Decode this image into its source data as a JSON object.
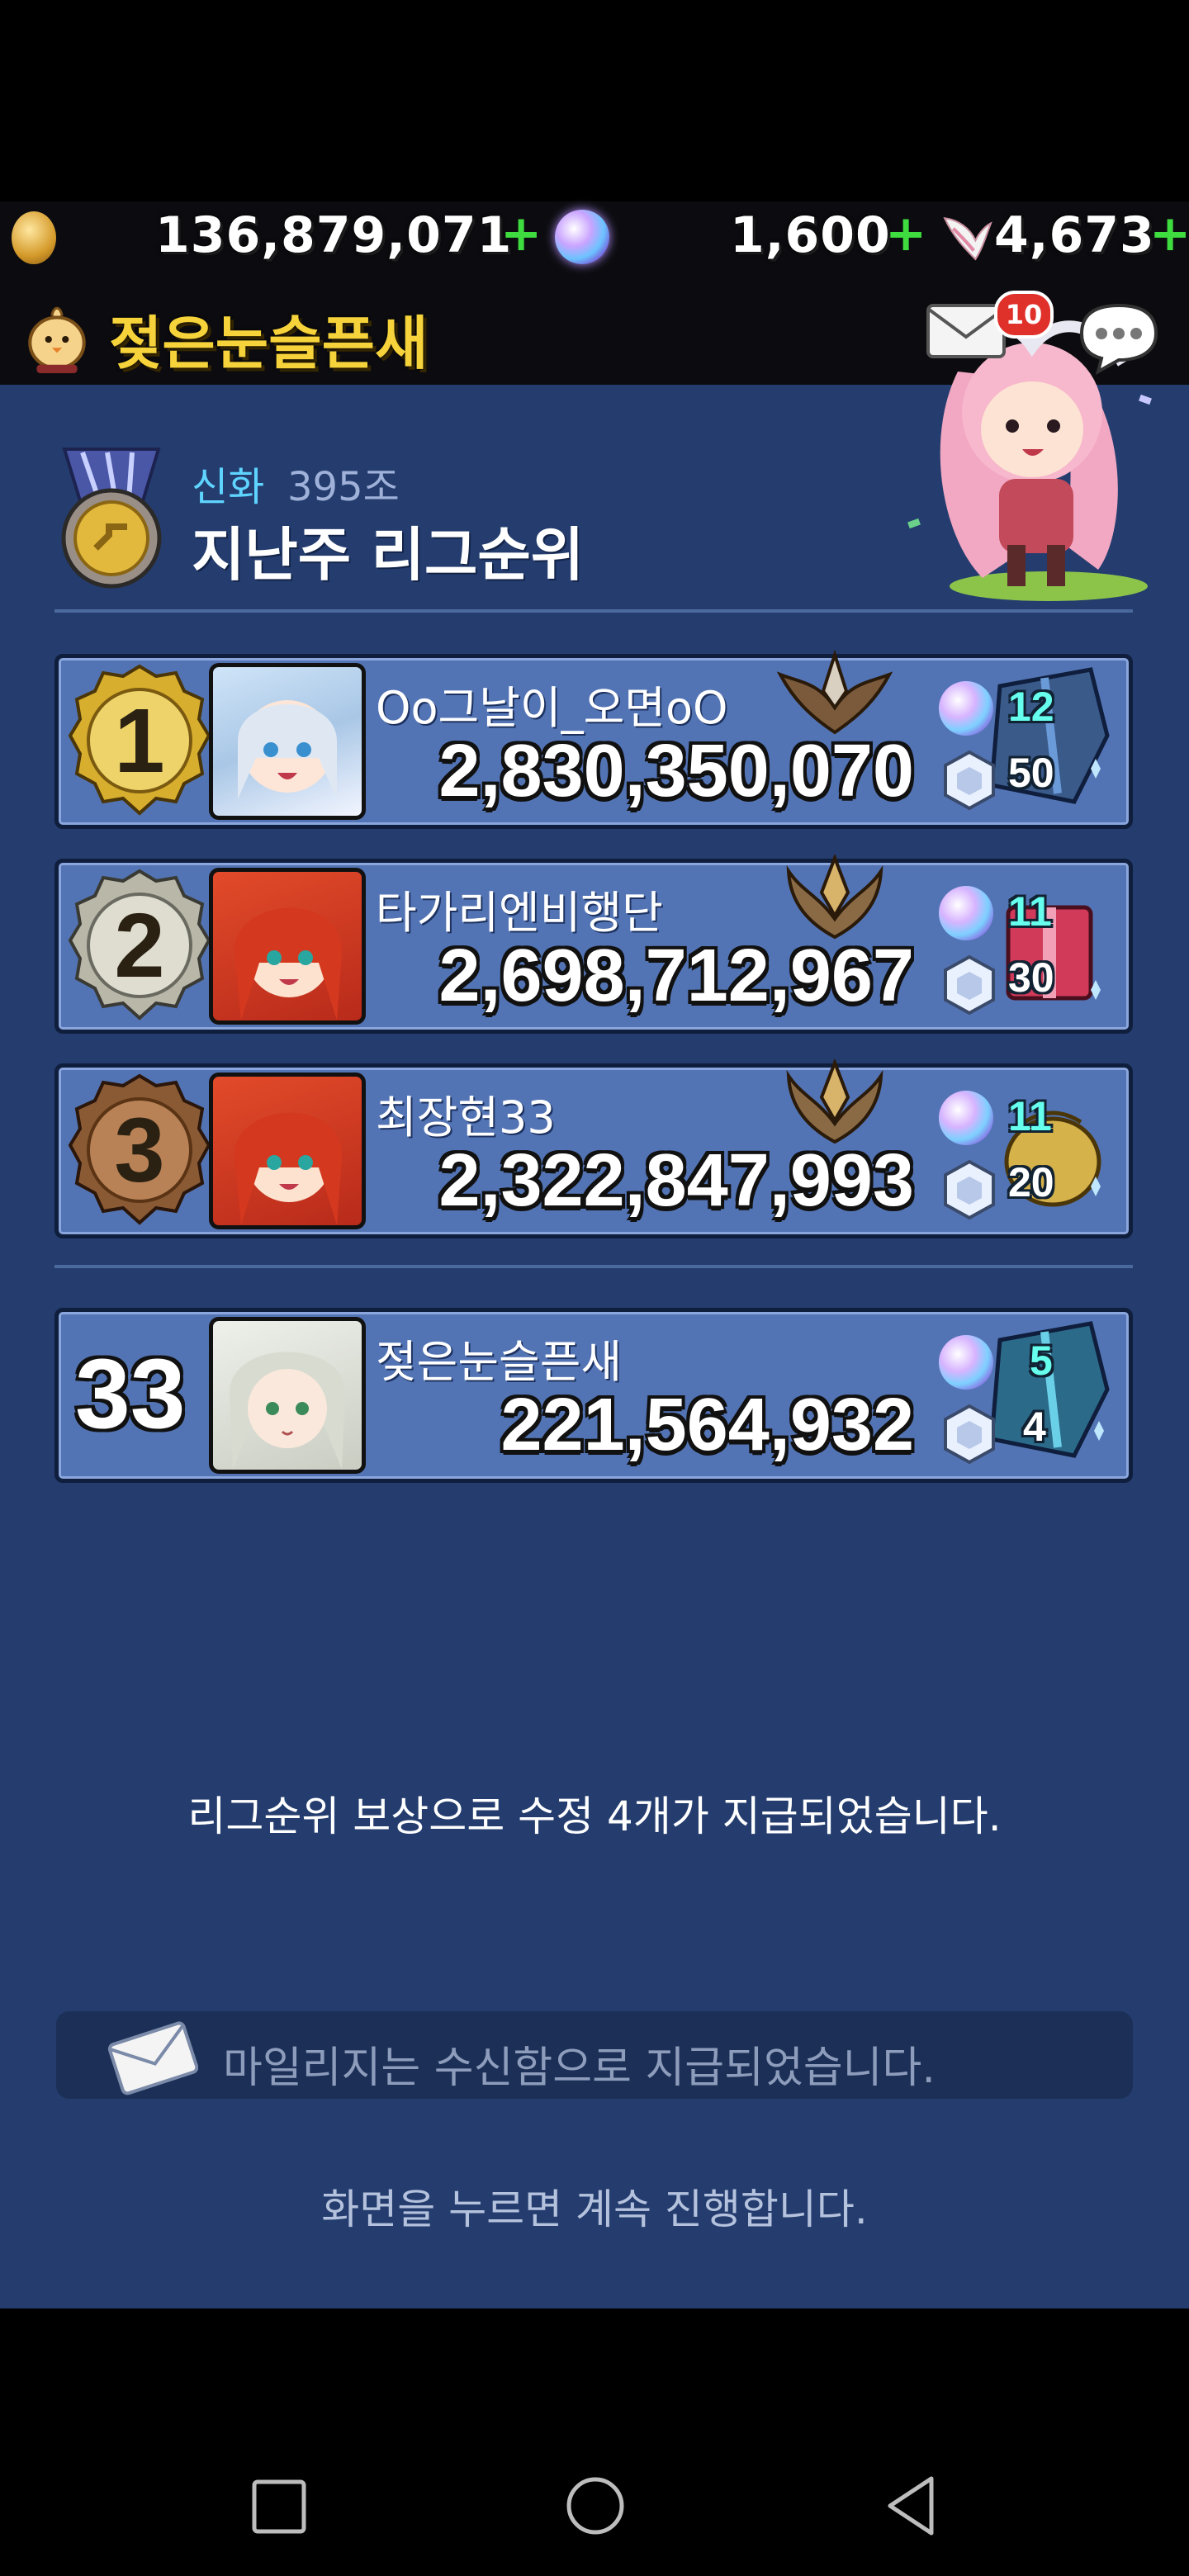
{
  "currency": {
    "gold": "136,879,071",
    "orbs": "1,600",
    "wings": "4,673",
    "plus": "+"
  },
  "header": {
    "player_name": "젖은눈슬픈새",
    "mail_badge": "10"
  },
  "league": {
    "tier": "신화",
    "tier_amount": "395조",
    "title": "지난주 리그순위"
  },
  "ranks": [
    {
      "rank": "1",
      "name": "Oo그날이_오면oO",
      "score": "2,830,350,070",
      "orb_reward": "12",
      "crystal_reward": "50"
    },
    {
      "rank": "2",
      "name": "타가리엔비행단",
      "score": "2,698,712,967",
      "orb_reward": "11",
      "crystal_reward": "30"
    },
    {
      "rank": "3",
      "name": "최장현33",
      "score": "2,322,847,993",
      "orb_reward": "11",
      "crystal_reward": "20"
    }
  ],
  "my_rank": {
    "rank": "33",
    "name": "젖은눈슬픈새",
    "score": "221,564,932",
    "orb_reward": "5",
    "crystal_reward": "4"
  },
  "messages": {
    "reward": "리그순위 보상으로 수정 4개가 지급되었습니다.",
    "mileage": "마일리지는 수신함으로 지급되었습니다.",
    "continue": "화면을 누르면 계속 진행합니다."
  },
  "colors": {
    "panel": "#243d6e",
    "row": "#5374b4",
    "title_yellow": "#f6d33b",
    "plus_green": "#3fdc3f"
  }
}
